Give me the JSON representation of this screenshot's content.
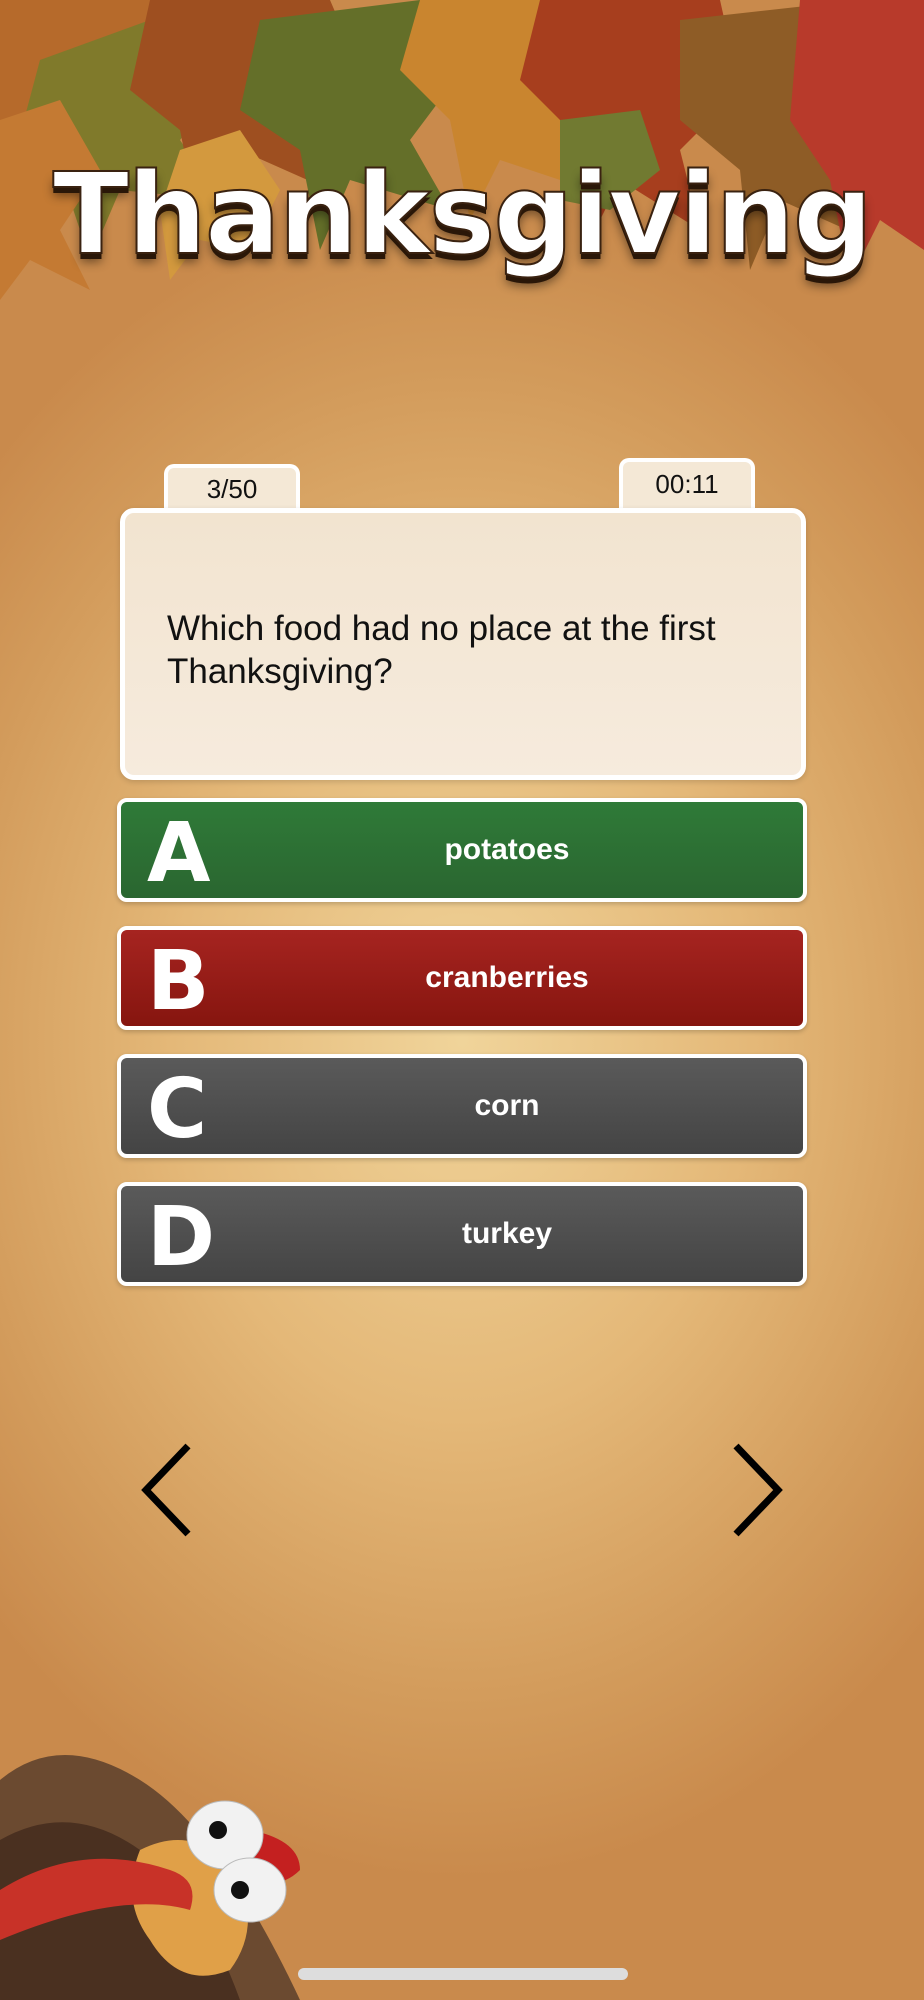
{
  "header": {
    "title": "Thanksgiving"
  },
  "quiz": {
    "counter": "3/50",
    "timer": "00:11",
    "question": "Which food had no place at the first Thanksgiving?",
    "answers": [
      {
        "letter": "A",
        "text": "potatoes",
        "state": "correct",
        "color": "#2d6f35"
      },
      {
        "letter": "B",
        "text": "cranberries",
        "state": "wrong",
        "color": "#951c16"
      },
      {
        "letter": "C",
        "text": "corn",
        "state": "neutral",
        "color": "#505050"
      },
      {
        "letter": "D",
        "text": "turkey",
        "state": "neutral",
        "color": "#505050"
      }
    ]
  },
  "nav": {
    "prev_icon": "chevron-left-icon",
    "next_icon": "chevron-right-icon"
  },
  "decor": {
    "top": "autumn-leaves",
    "bottom": "turkey-cartoon"
  }
}
